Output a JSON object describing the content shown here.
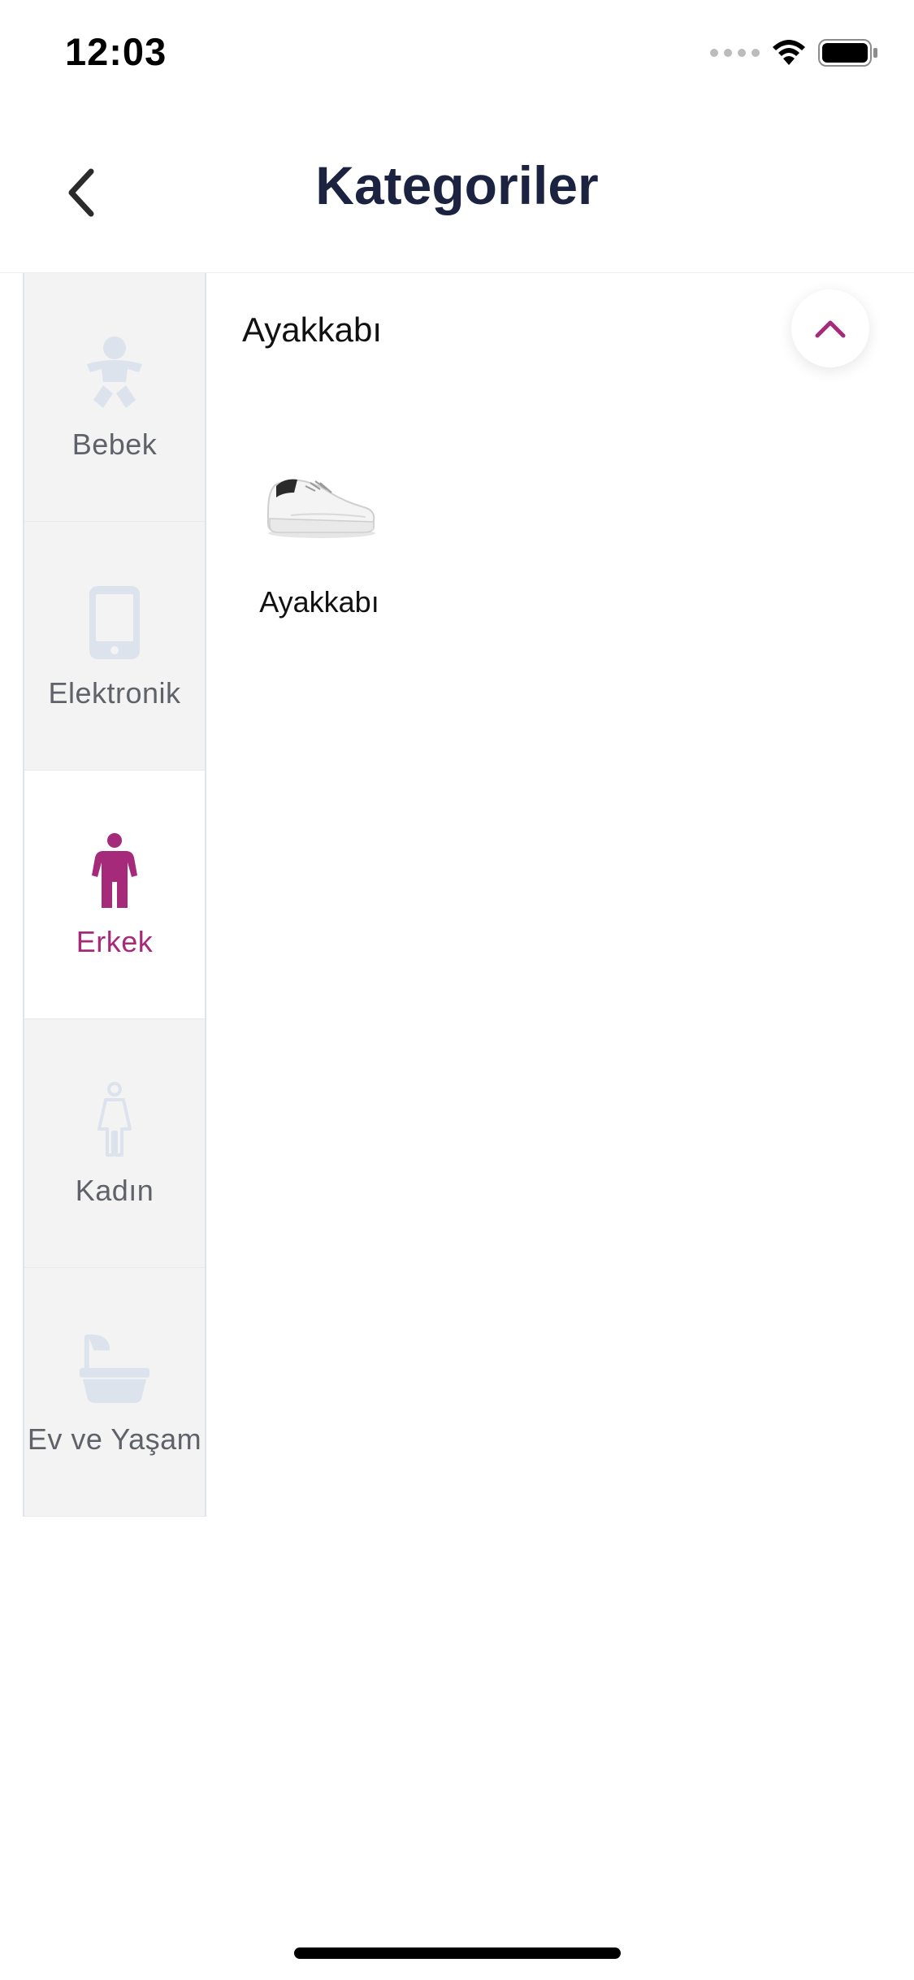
{
  "status_bar": {
    "time": "12:03",
    "icons": [
      "cellular-signal-icon",
      "wifi-icon",
      "battery-icon"
    ]
  },
  "header": {
    "back_icon": "chevron-left-icon",
    "title": "Kategoriler"
  },
  "sidebar": {
    "active_index": 2,
    "items": [
      {
        "label": "Bebek",
        "icon": "baby-icon"
      },
      {
        "label": "Elektronik",
        "icon": "phone-icon"
      },
      {
        "label": "Erkek",
        "icon": "man-icon"
      },
      {
        "label": "Kadın",
        "icon": "woman-icon"
      },
      {
        "label": "Ev ve Yaşam",
        "icon": "bathtub-icon"
      }
    ]
  },
  "main": {
    "section_title": "Ayakkabı",
    "collapse_icon": "chevron-up-icon",
    "products": [
      {
        "label": "Ayakkabı",
        "image": "sneaker-image"
      }
    ]
  },
  "colors": {
    "accent": "#a52a7a",
    "title": "#1c2340",
    "inactive_icon": "#dde3ec",
    "sidebar_bg": "#f3f3f4"
  }
}
